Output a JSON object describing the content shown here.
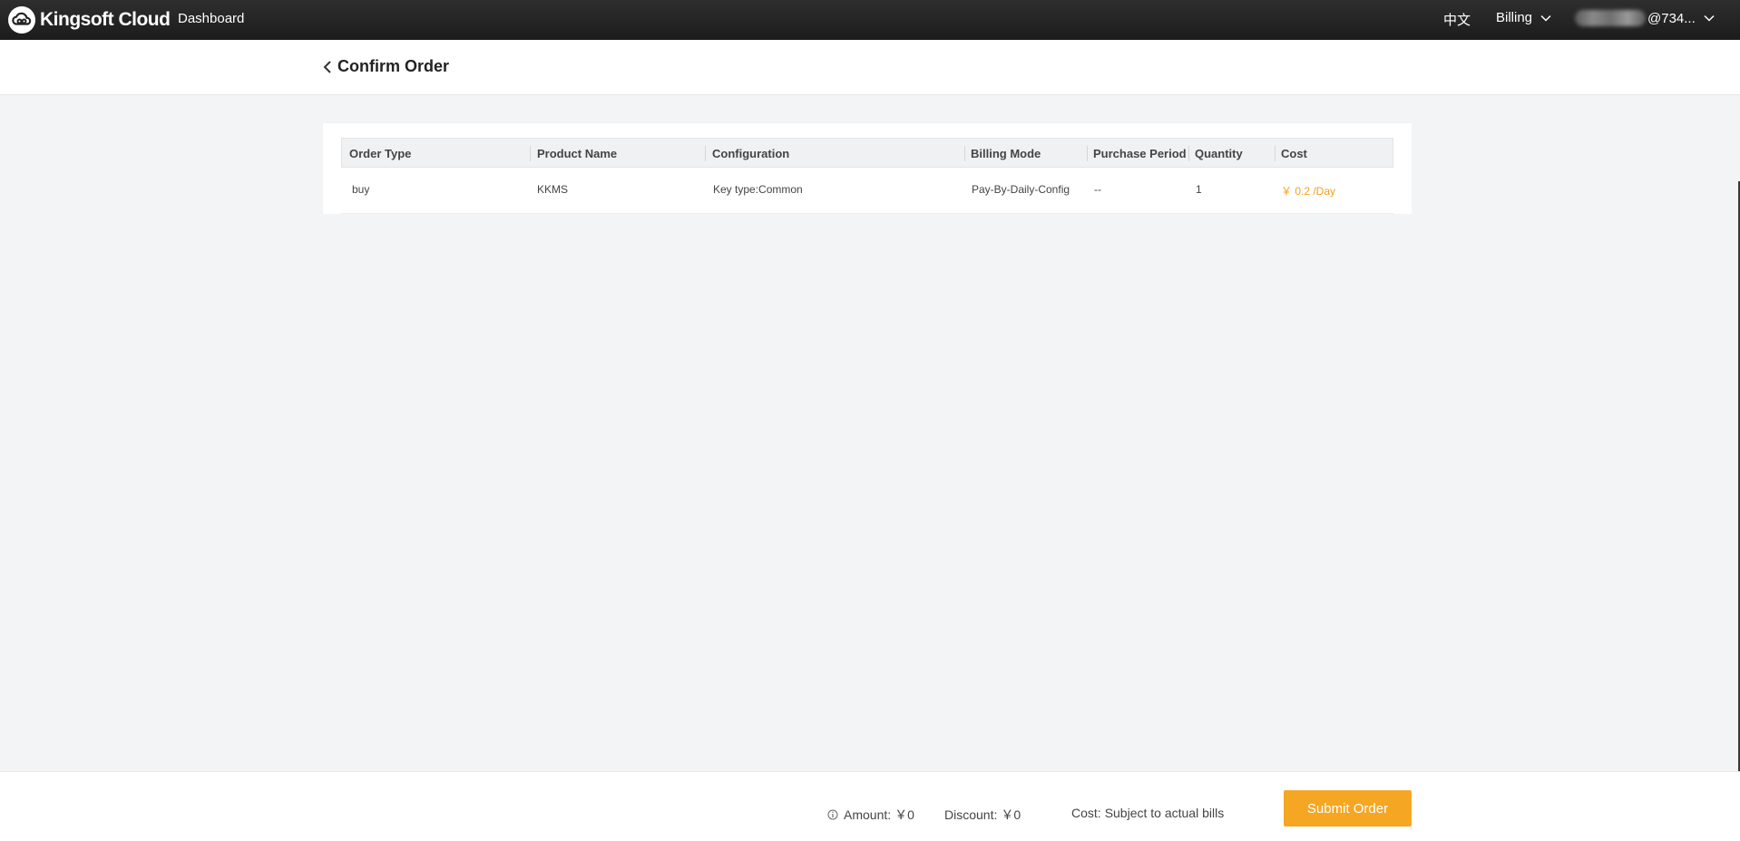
{
  "topbar": {
    "logo_text": "Kingsoft Cloud",
    "dashboard_label": "Dashboard",
    "language_label": "中文",
    "billing_label": "Billing",
    "user_label": "@734..."
  },
  "page": {
    "title": "Confirm Order"
  },
  "order_table": {
    "columns": [
      "Order Type",
      "Product Name",
      "Configuration",
      "Billing Mode",
      "Purchase Period",
      "Quantity",
      "Cost"
    ],
    "rows": [
      {
        "order_type": "buy",
        "product_name": "KKMS",
        "configuration": "Key type:Common",
        "billing_mode": "Pay-By-Daily-Config",
        "purchase_period": "--",
        "quantity": "1",
        "cost": "￥ 0.2 /Day"
      }
    ]
  },
  "footer": {
    "amount_label": "Amount:",
    "amount_value": "￥0",
    "discount_label": "Discount:",
    "discount_value": "￥0",
    "cost_label": "Cost:",
    "cost_value": "Subject to actual bills",
    "submit_label": "Submit Order"
  },
  "colors": {
    "accent": "#f5a623",
    "cost_text": "#f5a01a",
    "topbar": "#1e1e1e",
    "content_bg": "#f3f4f6"
  },
  "icons": {
    "logo": "cloud-logo-icon",
    "back": "chevron-left-icon",
    "dropdown": "chevron-down-icon",
    "info": "info-icon"
  }
}
